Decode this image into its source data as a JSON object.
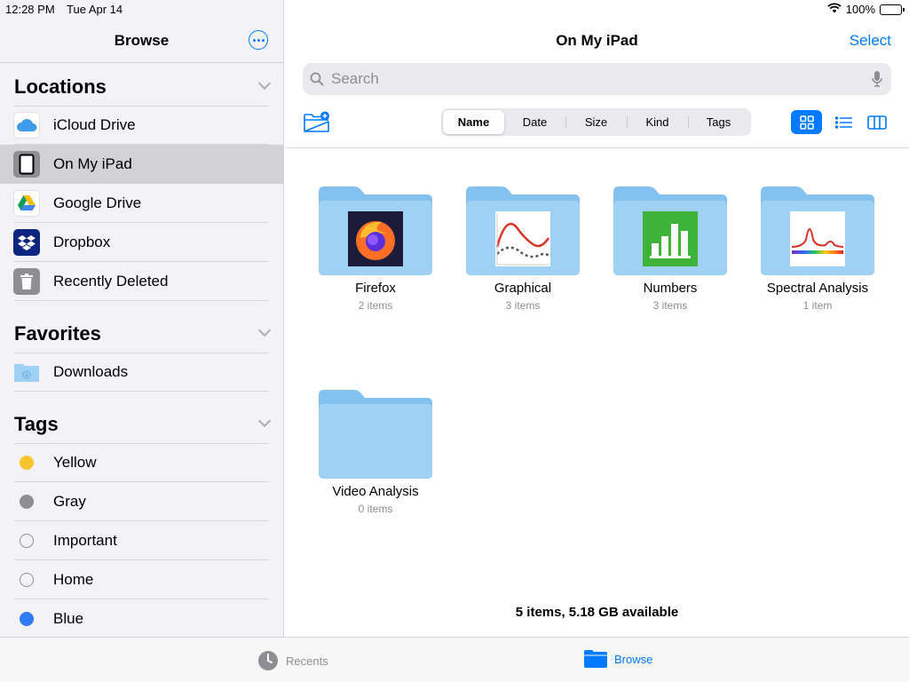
{
  "status": {
    "time": "12:28 PM",
    "date": "Tue Apr 14",
    "battery": "100%",
    "wifi_icon": "wifi-icon",
    "battery_level": 1.0
  },
  "sidebar": {
    "title": "Browse",
    "locations": {
      "title": "Locations",
      "items": [
        {
          "label": "iCloud Drive",
          "icon": "icloud-icon"
        },
        {
          "label": "On My iPad",
          "icon": "ipad-icon",
          "selected": true
        },
        {
          "label": "Google Drive",
          "icon": "google-drive-icon"
        },
        {
          "label": "Dropbox",
          "icon": "dropbox-icon"
        },
        {
          "label": "Recently Deleted",
          "icon": "trash-icon"
        }
      ]
    },
    "favorites": {
      "title": "Favorites",
      "items": [
        {
          "label": "Downloads",
          "icon": "downloads-folder-icon"
        }
      ]
    },
    "tags": {
      "title": "Tags",
      "items": [
        {
          "label": "Yellow",
          "color": "#f7c62f"
        },
        {
          "label": "Gray",
          "color": "#8e8e93"
        },
        {
          "label": "Important",
          "color": ""
        },
        {
          "label": "Home",
          "color": ""
        },
        {
          "label": "Blue",
          "color": "#2f7cf6"
        }
      ]
    }
  },
  "main": {
    "title": "On My iPad",
    "select_label": "Select",
    "search_placeholder": "Search",
    "sort_options": [
      "Name",
      "Date",
      "Size",
      "Kind",
      "Tags"
    ],
    "sort_selected": "Name",
    "folders": [
      {
        "name": "Firefox",
        "count": "2 items",
        "thumb": "firefox-app-icon"
      },
      {
        "name": "Graphical",
        "count": "3 items",
        "thumb": "graphical-app-icon"
      },
      {
        "name": "Numbers",
        "count": "3 items",
        "thumb": "numbers-app-icon"
      },
      {
        "name": "Spectral Analysis",
        "count": "1 item",
        "thumb": "spectral-app-icon"
      },
      {
        "name": "Video Analysis",
        "count": "0 items",
        "thumb": ""
      }
    ],
    "footer": "5 items, 5.18 GB available"
  },
  "tabbar": {
    "recents": "Recents",
    "browse": "Browse"
  },
  "colors": {
    "accent": "#007aff",
    "folder": "#9fd1f5",
    "folder_dark": "#83c2f0"
  }
}
